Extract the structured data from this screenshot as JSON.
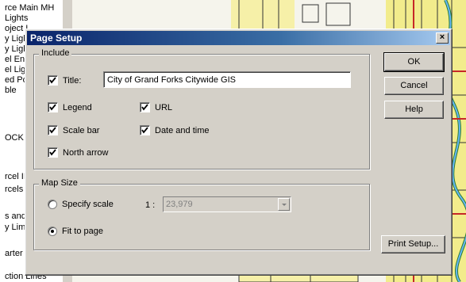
{
  "layers": [
    "rce Main MH",
    "Lights",
    "oject I",
    "y Ligh",
    "y Ligh",
    "el En",
    "el Lig",
    "ed Po",
    "ble",
    "OCK",
    "rcel II",
    "rcels",
    "s and",
    "y Limi",
    "arter",
    "ction Lines"
  ],
  "dialog": {
    "title": "Page Setup",
    "close_glyph": "×",
    "include": {
      "label": "Include",
      "title_label": "Title:",
      "title_value": "City of Grand Forks Citywide GIS",
      "legend_label": "Legend",
      "url_label": "URL",
      "scalebar_label": "Scale bar",
      "datetime_label": "Date and time",
      "northarrow_label": "North arrow"
    },
    "mapsize": {
      "label": "Map Size",
      "specify_label": "Specify scale",
      "ratio_label": "1 :",
      "scale_value": "23,979",
      "fit_label": "Fit to page"
    },
    "buttons": {
      "ok": "OK",
      "cancel": "Cancel",
      "help": "Help",
      "print_setup": "Print Setup..."
    }
  }
}
